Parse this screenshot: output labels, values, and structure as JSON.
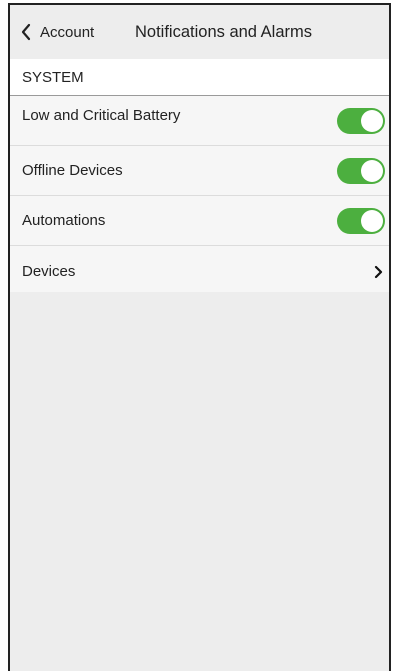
{
  "header": {
    "back_label": "Account",
    "title": "Notifications and Alarms"
  },
  "section": {
    "label": "SYSTEM"
  },
  "items": [
    {
      "label": "Low and Critical Battery",
      "control": "toggle",
      "enabled": true
    },
    {
      "label": "Offline Devices",
      "control": "toggle",
      "enabled": true
    },
    {
      "label": "Automations",
      "control": "toggle",
      "enabled": true
    },
    {
      "label": "Devices",
      "control": "chevron"
    }
  ],
  "colors": {
    "toggle_on": "#4caf3f",
    "background": "#ededed",
    "row_background": "#f6f6f6"
  },
  "icons": {
    "back": "chevron-left-icon",
    "disclosure": "chevron-right-icon"
  }
}
